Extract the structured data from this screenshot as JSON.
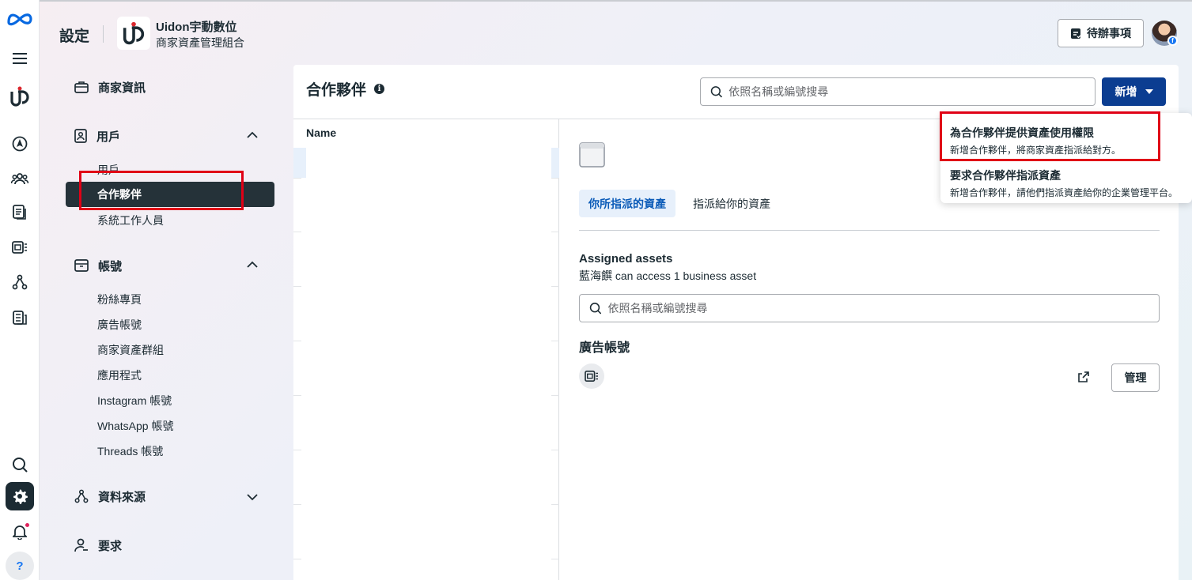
{
  "header": {
    "title": "設定",
    "business_name": "Uidon宇動數位",
    "business_sub": "商家資產管理組合",
    "todo_label": "待辦事項"
  },
  "nav": {
    "business_info": "商家資訊",
    "users": {
      "label": "用戶",
      "items": [
        "用戶",
        "合作夥伴",
        "系統工作人員"
      ]
    },
    "accounts": {
      "label": "帳號",
      "items": [
        "粉絲專頁",
        "廣告帳號",
        "商家資產群組",
        "應用程式",
        "Instagram 帳號",
        "WhatsApp 帳號",
        "Threads 帳號"
      ]
    },
    "data_sources": "資料來源",
    "requests": "要求"
  },
  "rail": {
    "help_label": "?"
  },
  "main": {
    "title": "合作夥伴",
    "search_placeholder": "依照名稱或編號搜尋",
    "add_label": "新增",
    "list_header": "Name",
    "tabs": [
      "你所指派的資產",
      "指派給你的資產"
    ],
    "assigned_title": "Assigned assets",
    "assigned_desc": "藍海饌 can access 1 business asset",
    "asset_search_placeholder": "依照名稱或編號搜尋",
    "section_title": "廣告帳號",
    "manage_label": "管理"
  },
  "dropdown": {
    "items": [
      {
        "title": "為合作夥伴提供資產使用權限",
        "desc": "新增合作夥伴，將商家資產指派給對方。"
      },
      {
        "title": "要求合作夥伴指派資產",
        "desc": "新增合作夥伴，請他們指派資產給你的企業管理平台。"
      }
    ]
  },
  "colors": {
    "primary": "#0b3d91",
    "active_nav": "#253239",
    "highlight": "#e00016",
    "tab_active_bg": "#e7f0fb"
  }
}
